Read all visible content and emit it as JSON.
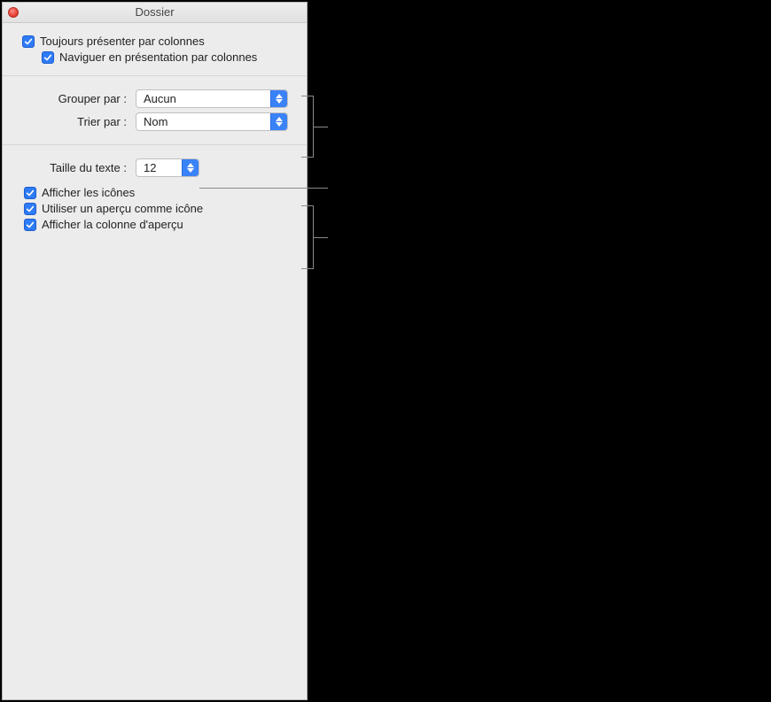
{
  "window": {
    "title": "Dossier"
  },
  "section1": {
    "always_columns": "Toujours présenter par colonnes",
    "navigate_columns": "Naviguer en présentation par colonnes"
  },
  "grouping": {
    "group_by_label": "Grouper par :",
    "group_by_value": "Aucun",
    "sort_by_label": "Trier par :",
    "sort_by_value": "Nom"
  },
  "text_size": {
    "label": "Taille du texte :",
    "value": "12"
  },
  "display_options": {
    "show_icons": "Afficher les icônes",
    "use_preview_icon": "Utiliser un aperçu comme icône",
    "show_preview_column": "Afficher la colonne d'aperçu"
  }
}
